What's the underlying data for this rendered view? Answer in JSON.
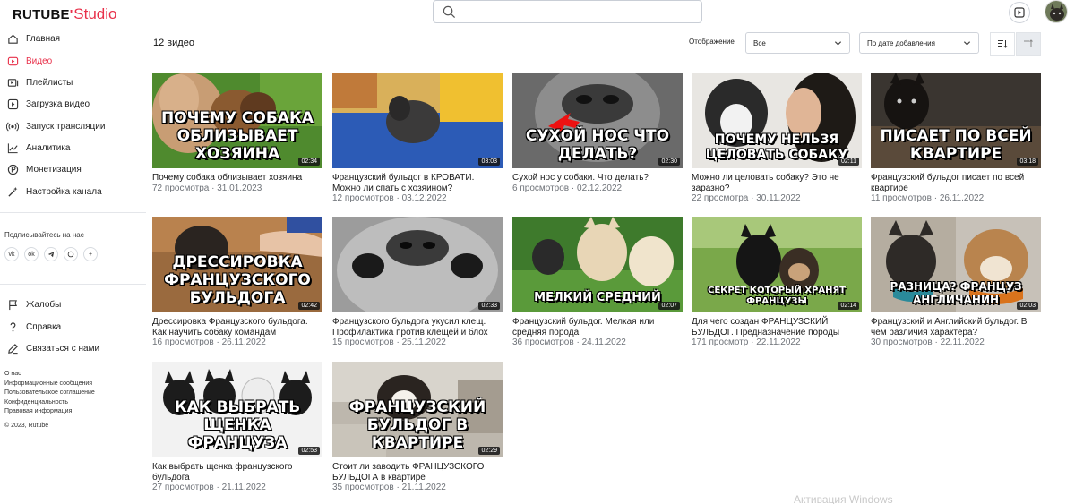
{
  "brand": {
    "rutube": "RUTUBE",
    "studio": "Studio",
    "accent": "#e8304a"
  },
  "search": {
    "placeholder": ""
  },
  "sidebar": {
    "items": [
      {
        "label": "Главная",
        "icon": "home-icon",
        "active": false
      },
      {
        "label": "Видео",
        "icon": "video-icon",
        "active": true
      },
      {
        "label": "Плейлисты",
        "icon": "playlist-icon",
        "active": false
      },
      {
        "label": "Загрузка видео",
        "icon": "upload-icon",
        "active": false
      },
      {
        "label": "Запуск трансляции",
        "icon": "broadcast-icon",
        "active": false
      },
      {
        "label": "Аналитика",
        "icon": "analytics-icon",
        "active": false
      },
      {
        "label": "Монетизация",
        "icon": "money-icon",
        "active": false
      },
      {
        "label": "Настройка канала",
        "icon": "settings-wand-icon",
        "active": false
      }
    ],
    "subscribe_title": "Подписывайтесь на нас",
    "socials": [
      "vk",
      "ok",
      "telegram",
      "viber",
      "+"
    ],
    "support": [
      {
        "label": "Жалобы",
        "icon": "flag-icon"
      },
      {
        "label": "Справка",
        "icon": "help-icon"
      },
      {
        "label": "Связаться с нами",
        "icon": "edit-icon"
      }
    ],
    "footer_links": [
      "О нас",
      "Информационные сообщения",
      "Пользовательское соглашение",
      "Конфиденциальность",
      "Правовая информация"
    ],
    "copyright": "© 2023, Rutube"
  },
  "toolbar": {
    "count": "12 видео",
    "view_label": "Отображение",
    "view_value": "Все",
    "sort_value": "По дате добавления"
  },
  "videos": [
    {
      "title": "Почему собака облизывает хозяина",
      "views": "72 просмотра",
      "date": "31.01.2023",
      "caption": "ПОЧЕМУ СОБАКА ОБЛИЗЫВАЕТ ХОЗЯИНА",
      "duration": "02:34"
    },
    {
      "title": "Французский бульдог в КРОВАТИ. Можно ли спать с хозяином?",
      "views": "12 просмотров",
      "date": "03.12.2022",
      "caption": "",
      "duration": "03:03"
    },
    {
      "title": "Сухой нос у собаки. Что делать?",
      "views": "6 просмотров",
      "date": "02.12.2022",
      "caption": "СУХОЙ НОС          ЧТО ДЕЛАТЬ?",
      "duration": "02:30"
    },
    {
      "title": "Можно ли целовать собаку? Это не заразно?",
      "views": "22 просмотра",
      "date": "30.11.2022",
      "caption": "ПОЧЕМУ НЕЛЬЗЯ ЦЕЛОВАТЬ СОБАКУ",
      "duration": "02:11"
    },
    {
      "title": "Французский бульдог писает по всей квартире",
      "views": "11 просмотров",
      "date": "26.11.2022",
      "caption": "ПИСАЕТ ПО ВСЕЙ КВАРТИРЕ",
      "duration": "03:18"
    },
    {
      "title": "Дрессировка Французского бульдога. Как научить собаку командам",
      "views": "16 просмотров",
      "date": "26.11.2022",
      "caption": "ДРЕССИРОВКА ФРАНЦУЗСКОГО БУЛЬДОГА",
      "duration": "02:42"
    },
    {
      "title": "Французского бульдога укусил клещ. Профилактика против клещей и блох",
      "views": "15 просмотров",
      "date": "25.11.2022",
      "caption": "",
      "duration": "02:33"
    },
    {
      "title": "Французский бульдог. Мелкая или средняя порода",
      "views": "36 просмотров",
      "date": "24.11.2022",
      "caption": "МЕЛКИЙ          СРЕДНИЙ",
      "duration": "02:07"
    },
    {
      "title": "Для чего создан ФРАНЦУЗСКИЙ БУЛЬДОГ. Предназначение породы",
      "views": "171 просмотр",
      "date": "22.11.2022",
      "caption": "СЕКРЕТ КОТОРЫЙ ХРАНЯТ ФРАНЦУЗЫ",
      "duration": "02:14"
    },
    {
      "title": "Французский и Английский бульдог. В чём различия характера?",
      "views": "30 просмотров",
      "date": "22.11.2022",
      "caption": "РАЗНИЦА?  ФРАНЦУЗ   АНГЛИЧАНИН",
      "duration": "02:03"
    },
    {
      "title": "Как выбрать щенка французского бульдога",
      "views": "27 просмотров",
      "date": "21.11.2022",
      "caption": "КАК ВЫБРАТЬ ЩЕНКА ФРАНЦУЗА",
      "duration": "02:53"
    },
    {
      "title": "Стоит ли заводить ФРАНЦУЗСКОГО БУЛЬДОГА в квартире",
      "views": "35 просмотров",
      "date": "21.11.2022",
      "caption": "ФРАНЦУЗСКИЙ БУЛЬДОГ В КВАРТИРЕ",
      "duration": "02:29"
    }
  ],
  "watermark": "Активация Windows"
}
